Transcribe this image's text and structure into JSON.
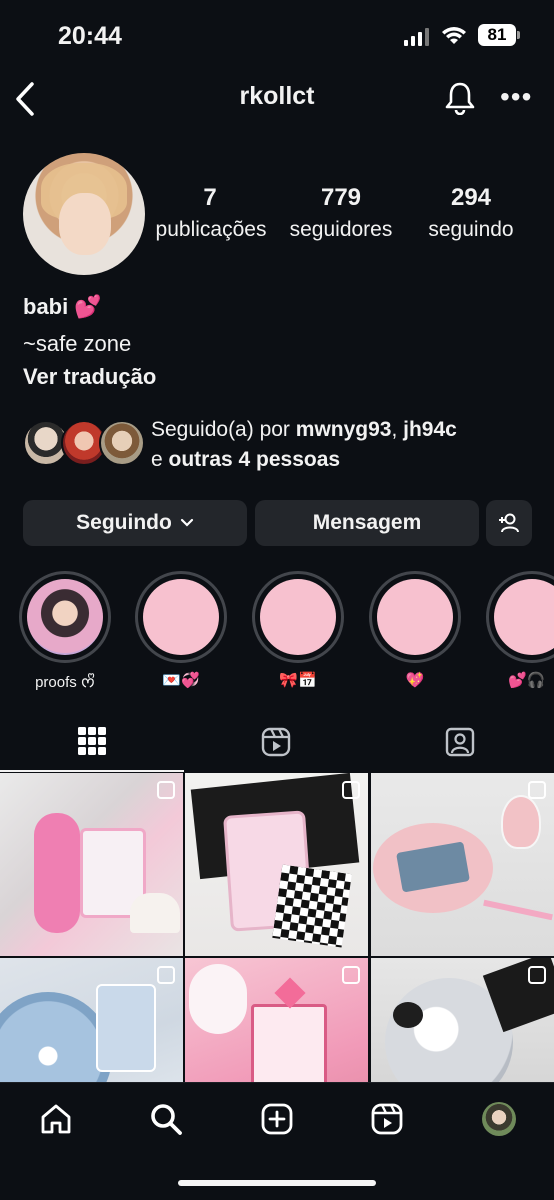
{
  "status_bar": {
    "time": "20:44",
    "battery": "81"
  },
  "header": {
    "username": "rkollct"
  },
  "stats": [
    {
      "value": "7",
      "label": "publicações"
    },
    {
      "value": "779",
      "label": "seguidores"
    },
    {
      "value": "294",
      "label": "seguindo"
    }
  ],
  "bio": {
    "name": "babi 💕",
    "text": "~safe zone",
    "translate": "Ver tradução"
  },
  "followed_by": {
    "prefix": "Seguido(a) por ",
    "user1": "mwnyg93",
    "sep": ", ",
    "user2": "jh94c",
    "middle": "e ",
    "others": "outras 4 pessoas"
  },
  "actions": {
    "following": "Seguindo",
    "message": "Mensagem"
  },
  "highlights": [
    {
      "label": "proofs ᰔᩚ"
    },
    {
      "label": "💌💞"
    },
    {
      "label": "🎀📅"
    },
    {
      "label": "💖"
    },
    {
      "label": "💕🎧"
    }
  ],
  "colors": {
    "background": "#0c0f14",
    "button": "#23262b",
    "highlight_pink": "#f7c1cf"
  },
  "icons": [
    "back-icon",
    "bell-icon",
    "more-icon",
    "chevron-down-icon",
    "add-person-icon",
    "grid-icon",
    "reels-icon",
    "tagged-icon",
    "home-icon",
    "search-icon",
    "create-icon",
    "reels-nav-icon",
    "profile-avatar"
  ]
}
